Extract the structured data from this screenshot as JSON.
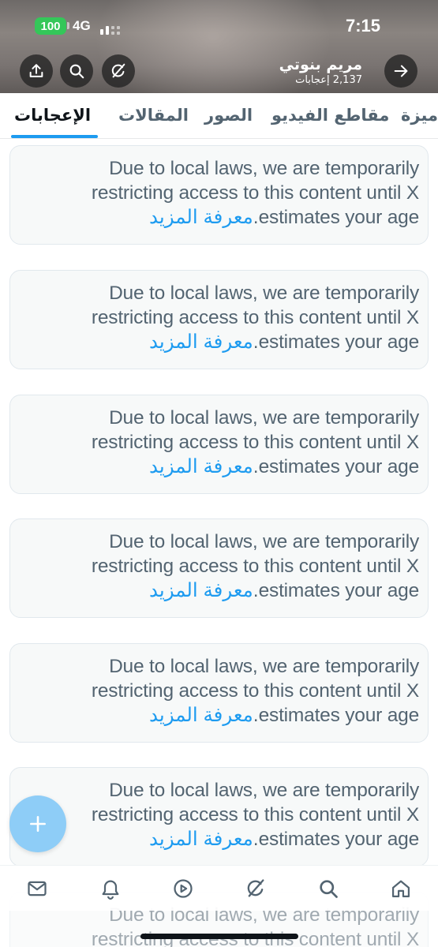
{
  "status_bar": {
    "battery": "100",
    "network": "4G",
    "time": "7:15"
  },
  "profile": {
    "name": "مريم بنوتي",
    "count": "2,137 إعجابات"
  },
  "header_icons": [
    "share-icon",
    "search-icon",
    "grok-icon",
    "back-arrow-icon"
  ],
  "tabs": [
    {
      "label": "الإعجابات",
      "active": true
    },
    {
      "label": "المقالات",
      "active": false
    },
    {
      "label": "الصور",
      "active": false
    },
    {
      "label": "مقاطع الفيديو",
      "active": false
    },
    {
      "label": "ميزة",
      "active": false
    }
  ],
  "notices": [
    {
      "text": "Due to local laws, we are temporarily restricting access to this content until X estimates your age.",
      "link": "معرفة المزيد"
    },
    {
      "text": "Due to local laws, we are temporarily restricting access to this content until X estimates your age.",
      "link": "معرفة المزيد"
    },
    {
      "text": "Due to local laws, we are temporarily restricting access to this content until X estimates your age.",
      "link": "معرفة المزيد"
    },
    {
      "text": "Due to local laws, we are temporarily restricting access to this content until X estimates your age.",
      "link": "معرفة المزيد"
    },
    {
      "text": "Due to local laws, we are temporarily restricting access to this content until X estimates your age.",
      "link": "معرفة المزيد"
    },
    {
      "text": "Due to local laws, we are temporarily restricting access to this content until X estimates your age.",
      "link": "معرفة المزيد"
    },
    {
      "text": "Due to local laws, we are temporarily restricting access to this content until X",
      "link": ""
    }
  ],
  "line_parts": {
    "line1": "Due to local laws, we are temporarily",
    "line2": "restricting access to this content until X",
    "line3_suffix": ".estimates your age"
  },
  "fab": {
    "icon": "plus-icon"
  },
  "bottom_nav": [
    "mail-icon",
    "bell-icon",
    "play-icon",
    "grok-icon",
    "search-icon",
    "home-icon"
  ],
  "colors": {
    "accent": "#1d9bf0",
    "text_secondary": "#536471",
    "text_primary": "#0f1419",
    "battery": "#34c759"
  }
}
